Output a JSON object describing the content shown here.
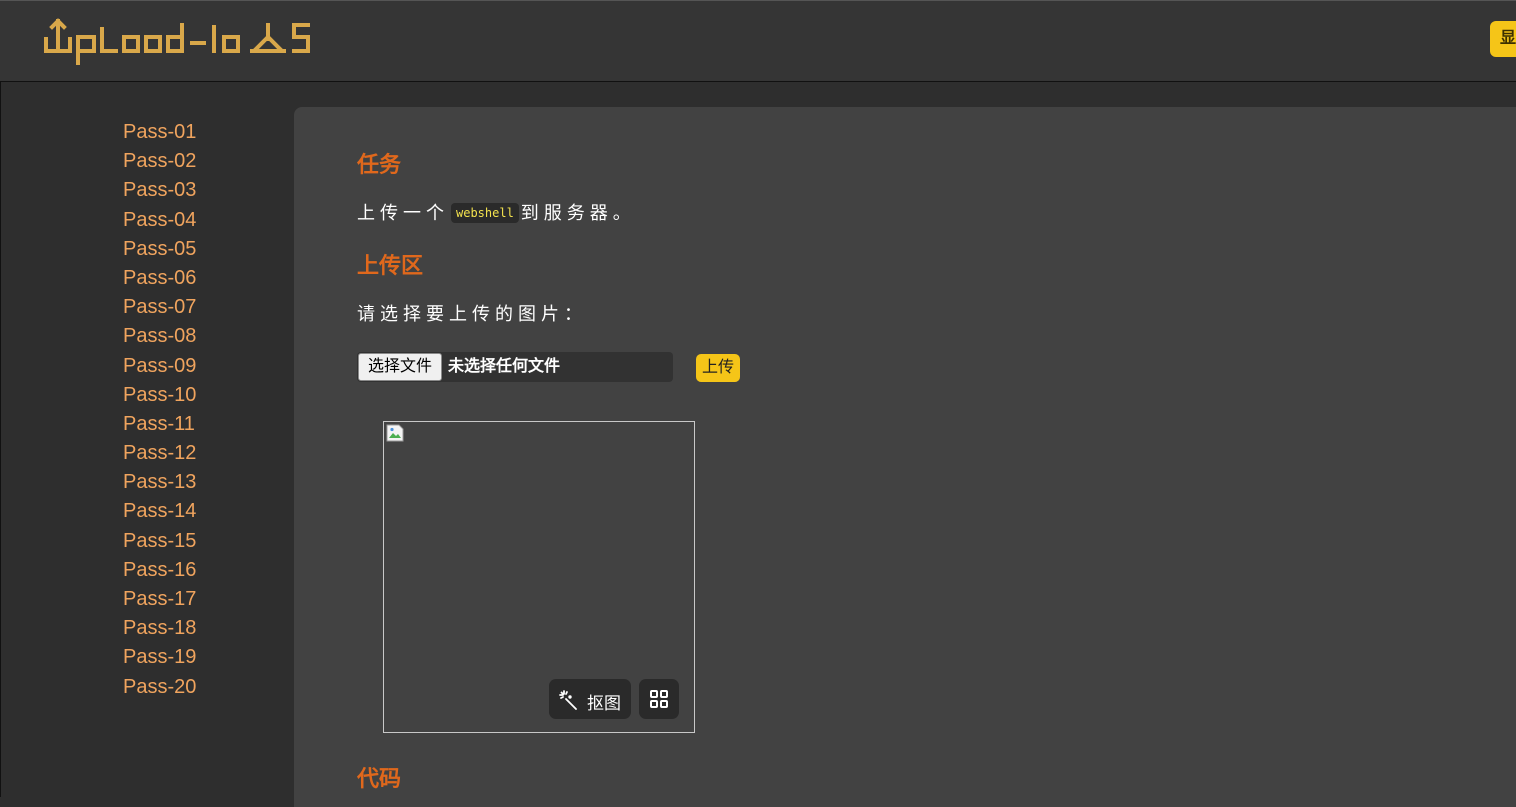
{
  "header": {
    "logo_text": "Upload-labs",
    "show_button_label": "显"
  },
  "sidebar": {
    "items": [
      "Pass-01",
      "Pass-02",
      "Pass-03",
      "Pass-04",
      "Pass-05",
      "Pass-06",
      "Pass-07",
      "Pass-08",
      "Pass-09",
      "Pass-10",
      "Pass-11",
      "Pass-12",
      "Pass-13",
      "Pass-14",
      "Pass-15",
      "Pass-16",
      "Pass-17",
      "Pass-18",
      "Pass-19",
      "Pass-20"
    ]
  },
  "main": {
    "task_heading": "任务",
    "task_pre": "上传一个",
    "task_code": "webshell",
    "task_post": "到服务器。",
    "upload_heading": "上传区",
    "upload_prompt": "请选择要上传的图片：",
    "file_button_label": "选择文件",
    "file_status": "未选择任何文件",
    "upload_button_label": "上传",
    "cutout_label": "抠图",
    "code_heading": "代码"
  },
  "colors": {
    "accent_orange": "#e0681c",
    "link_orange": "#f0a45e",
    "button_yellow": "#f5c518",
    "logo_gold": "#d9a84a"
  }
}
